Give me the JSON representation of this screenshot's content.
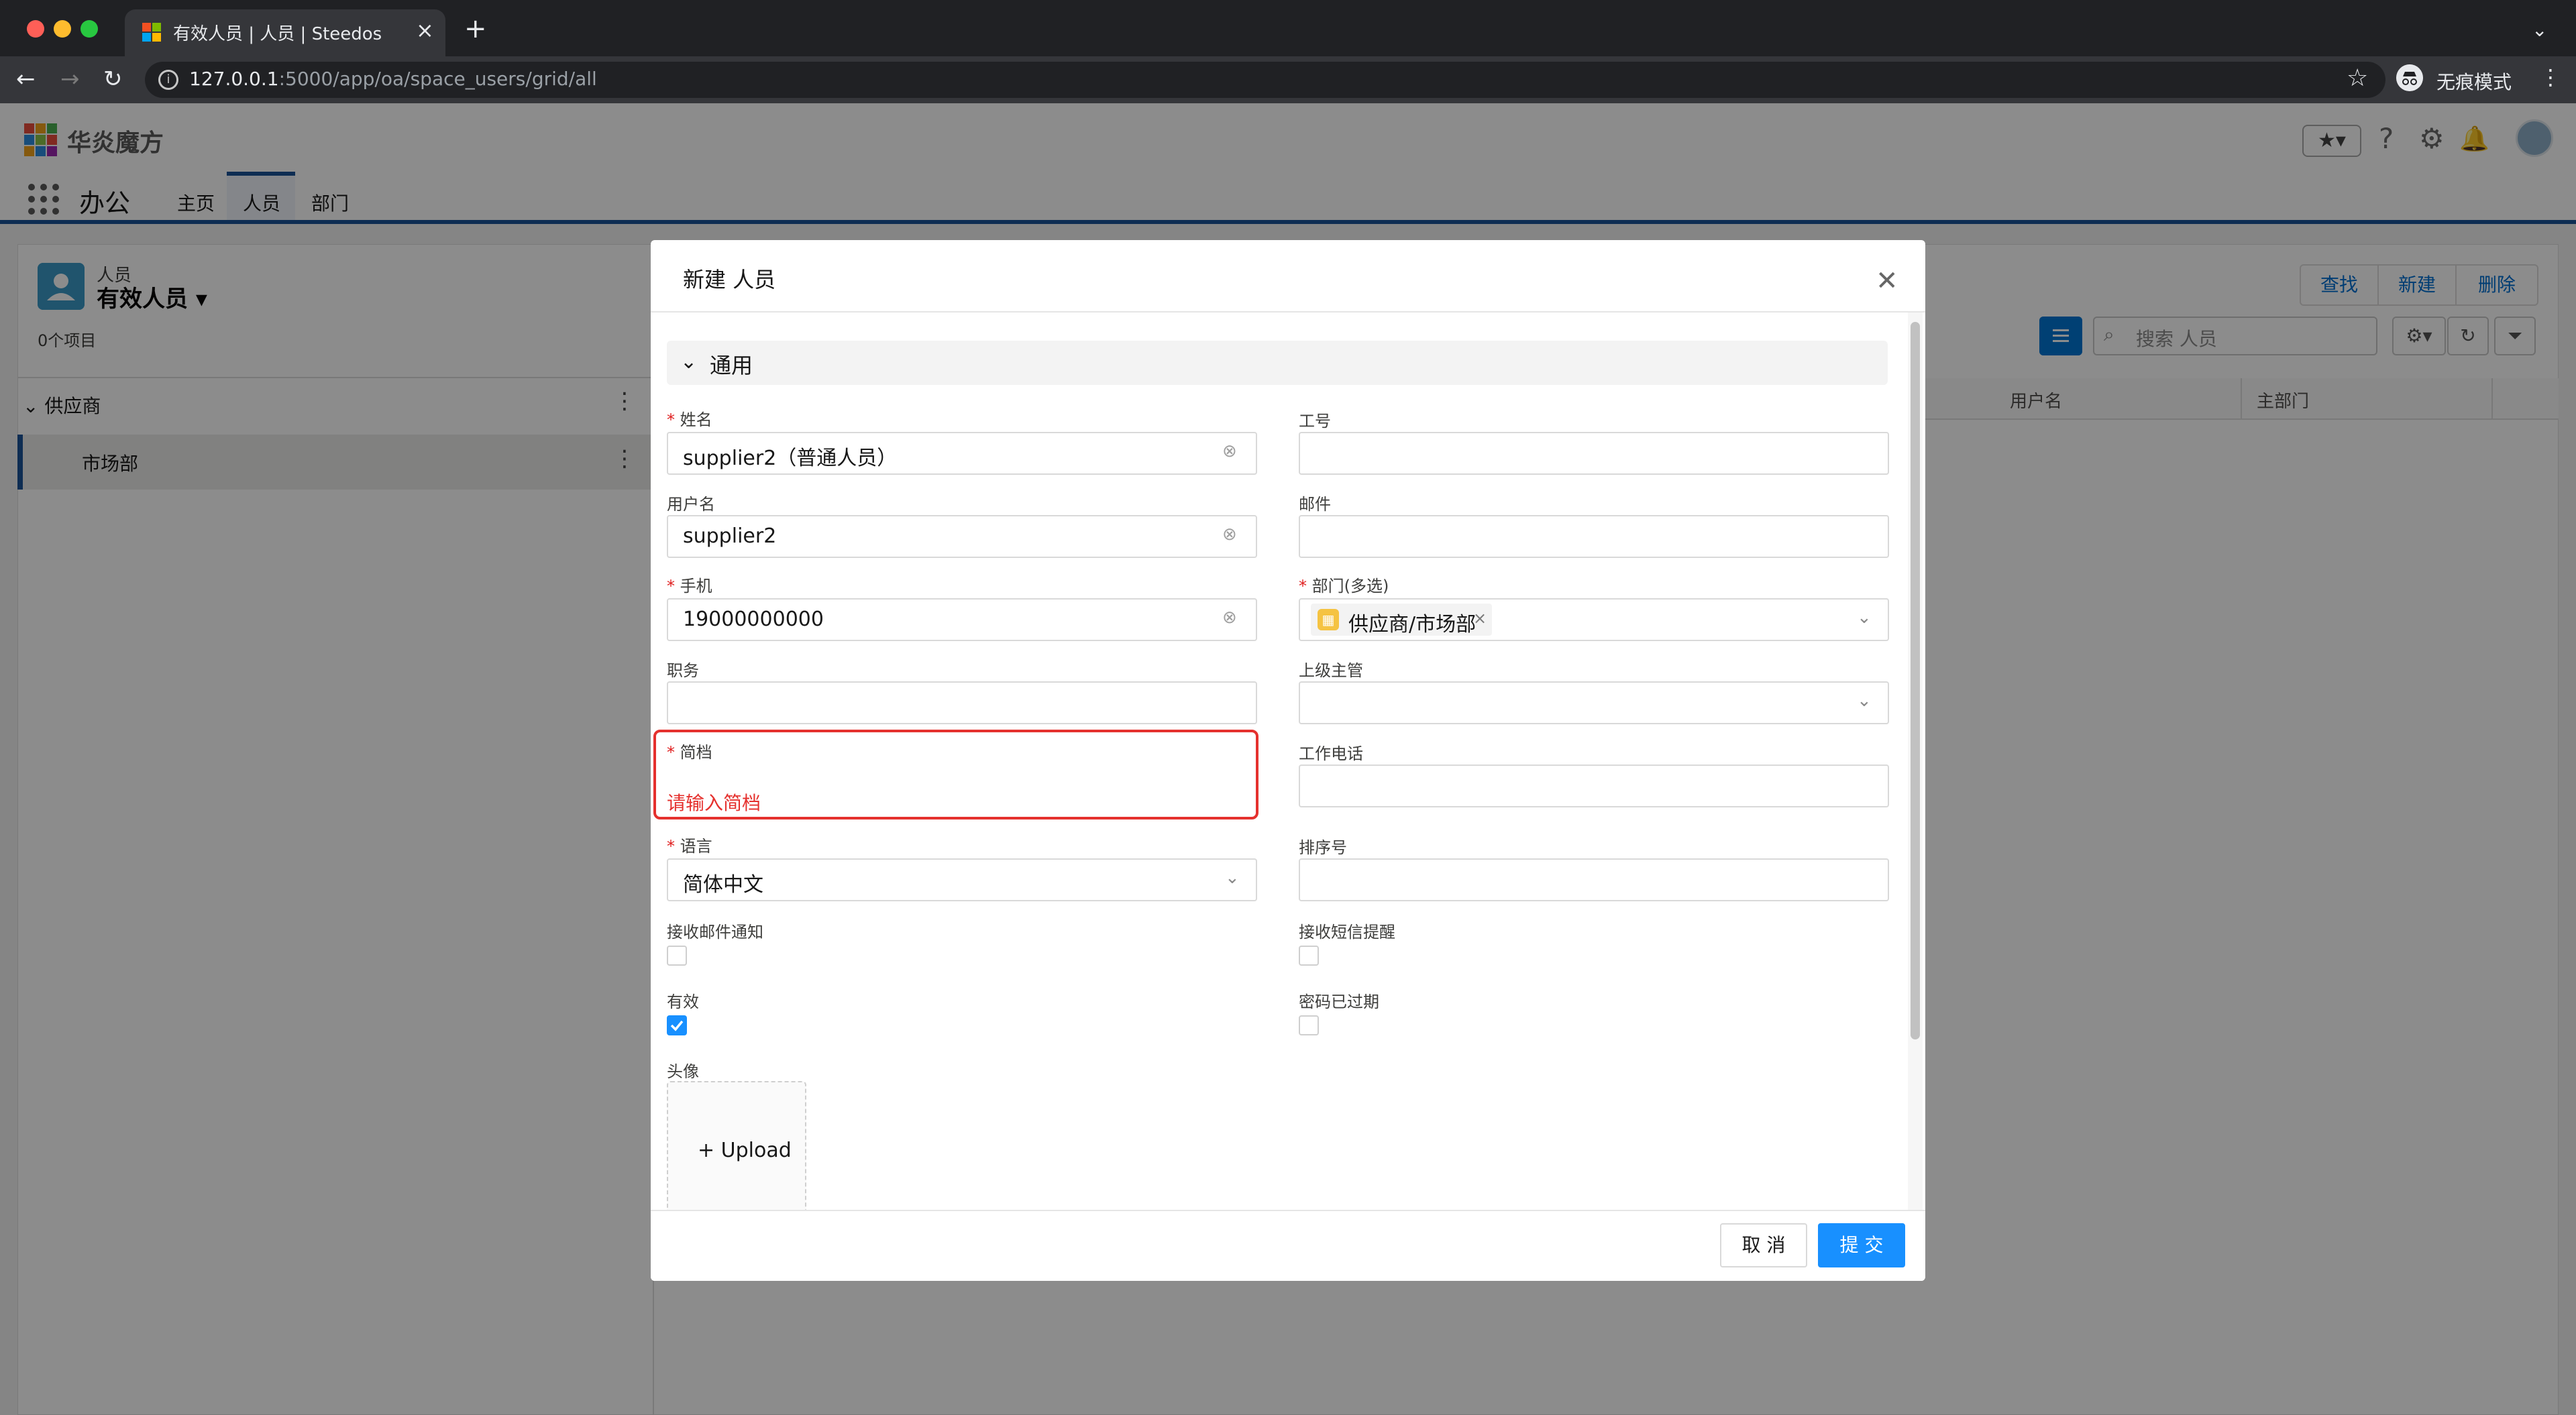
{
  "browser": {
    "tab_title": "有效人员 | 人员 | Steedos",
    "url_host": "127.0.0.1",
    "url_rest": ":5000/app/oa/space_users/grid/all",
    "incognito_label": "无痕模式",
    "new_tab": "+",
    "tab_close": "×"
  },
  "header": {
    "logo_text": "华炎魔方",
    "app_name": "办公",
    "nav_tabs": [
      {
        "label": "主页"
      },
      {
        "label": "人员"
      },
      {
        "label": "部门"
      }
    ],
    "active_tab": "人员"
  },
  "left_panel": {
    "object_label": "人员",
    "list_name": "有效人员",
    "item_count": "0个项目",
    "tree": [
      {
        "label": "供应商"
      },
      {
        "label": "市场部"
      }
    ]
  },
  "right_panel": {
    "actions": [
      {
        "label": "查找"
      },
      {
        "label": "新建"
      },
      {
        "label": "删除"
      }
    ],
    "search_placeholder": "搜索 人员",
    "columns": [
      {
        "label": "用户名"
      },
      {
        "label": "主部门"
      }
    ]
  },
  "modal": {
    "title": "新建 人员",
    "section": "通用",
    "fields": {
      "name": {
        "label": "姓名",
        "required": true,
        "value": "supplier2（普通人员）"
      },
      "employee_no": {
        "label": "工号",
        "value": ""
      },
      "username": {
        "label": "用户名",
        "value": "supplier2"
      },
      "email": {
        "label": "邮件",
        "value": ""
      },
      "mobile": {
        "label": "手机",
        "required": true,
        "value": "19000000000"
      },
      "department": {
        "label": "部门(多选)",
        "required": true,
        "tag": "供应商/市场部"
      },
      "position": {
        "label": "职务",
        "value": ""
      },
      "manager": {
        "label": "上级主管",
        "value": ""
      },
      "profile": {
        "label": "简档",
        "required": true,
        "error": "请输入简档"
      },
      "work_phone": {
        "label": "工作电话",
        "value": ""
      },
      "language": {
        "label": "语言",
        "required": true,
        "value": "简体中文"
      },
      "sort_no": {
        "label": "排序号",
        "value": ""
      },
      "email_notify": {
        "label": "接收邮件通知",
        "checked": false
      },
      "sms_notify": {
        "label": "接收短信提醒",
        "checked": false
      },
      "active": {
        "label": "有效",
        "checked": true
      },
      "password_expired": {
        "label": "密码已过期",
        "checked": false
      },
      "avatar": {
        "label": "头像",
        "upload_label": "+ Upload"
      }
    },
    "cancel_label": "取 消",
    "submit_label": "提 交"
  },
  "colors": {
    "brand_blue": "#1b5297",
    "primary": "#1890ff",
    "error": "#e5312e",
    "checkbox_checked": "#1890ff"
  }
}
